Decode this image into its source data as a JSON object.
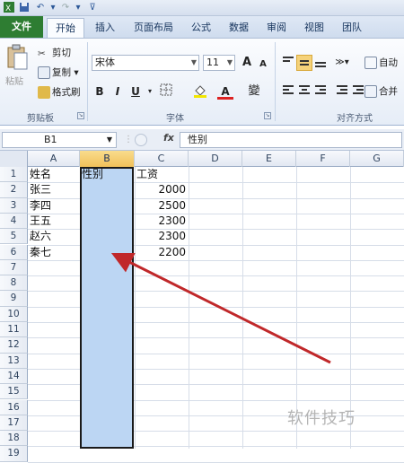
{
  "tabs": [
    "文件",
    "开始",
    "插入",
    "页面布局",
    "公式",
    "数据",
    "审阅",
    "视图",
    "团队"
  ],
  "clipboard": {
    "paste": "粘贴",
    "cut": "剪切",
    "copy": "复制",
    "format_painter": "格式刷",
    "group": "剪贴板"
  },
  "font": {
    "name": "宋体",
    "size": "11",
    "grow": "A",
    "shrink": "A",
    "bold": "B",
    "italic": "I",
    "underline": "U",
    "font_color": "A",
    "phonetic": "變",
    "group": "字体"
  },
  "alignment": {
    "wrap": "自动",
    "merge": "合并",
    "group": "对齐方式"
  },
  "formula_bar": {
    "name_box": "B1",
    "fx": "fx",
    "content": "性别"
  },
  "columns": [
    "A",
    "B",
    "C",
    "D",
    "E",
    "F",
    "G"
  ],
  "rows": [
    "1",
    "2",
    "3",
    "4",
    "5",
    "6",
    "7",
    "8",
    "9",
    "10",
    "11",
    "12",
    "13",
    "14",
    "15",
    "16",
    "17",
    "18",
    "19"
  ],
  "cells": {
    "A1": "姓名",
    "B1": "性别",
    "C1": "工资",
    "A2": "张三",
    "C2": "2000",
    "A3": "李四",
    "C3": "2500",
    "A4": "王五",
    "C4": "2300",
    "A5": "赵六",
    "C5": "2300",
    "A6": "秦七",
    "C6": "2200"
  },
  "selected_column": "B",
  "watermark": "软件技巧",
  "colors": {
    "file_tab": "#2e7d32",
    "selection": "#bcd6f3",
    "arrow": "#c0282a"
  }
}
